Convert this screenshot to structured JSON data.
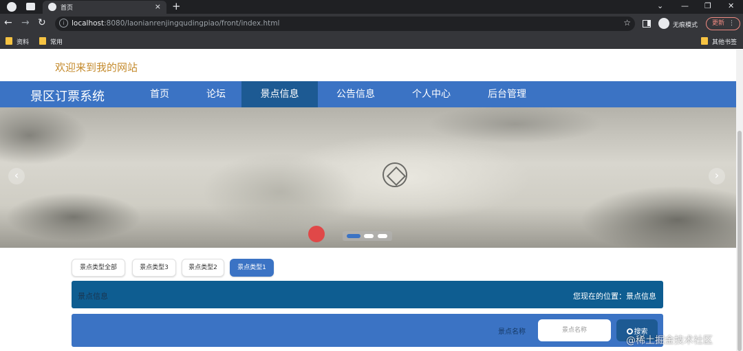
{
  "browser": {
    "tab_title": "首页",
    "url_host": "localhost",
    "url_rest": ":8080/laonianrenjingqudingpiao/front/index.html",
    "incognito_label": "无痕模式",
    "update_label": "更新",
    "bookmarks": [
      "资料",
      "常用"
    ],
    "other_bookmarks": "其他书签"
  },
  "site": {
    "welcome": "欢迎来到我的网站",
    "brand": "景区订票系统",
    "nav": [
      "首页",
      "论坛",
      "景点信息",
      "公告信息",
      "个人中心",
      "后台管理"
    ],
    "active_nav": "景点信息"
  },
  "filters": {
    "items": [
      "景点类型全部",
      "景点类型3",
      "景点类型2",
      "景点类型1"
    ],
    "active": "景点类型1"
  },
  "breadcrumb": {
    "left": "景点信息",
    "right": "您现在的位置：景点信息"
  },
  "search": {
    "label": "景点名称",
    "placeholder": "景点名称",
    "button": "搜索"
  },
  "watermark": "@稀土掘金技术社区",
  "colors": {
    "nav_bg": "#3b73c4",
    "nav_active": "#1d5a93",
    "breadcrumb_bg": "#0e5d91",
    "welcome": "#c48a2c"
  }
}
